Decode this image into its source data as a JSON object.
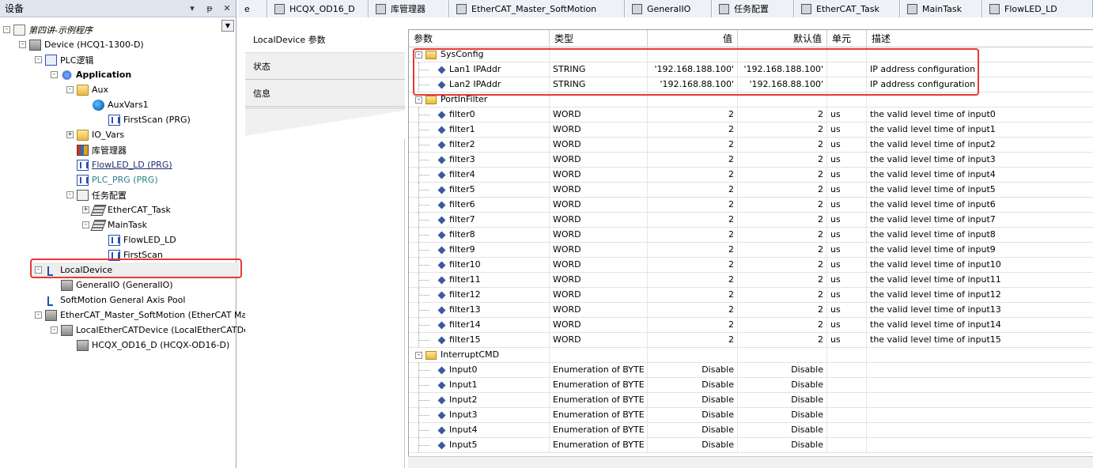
{
  "device_panel": {
    "title": "设备",
    "btn_dropdown": "▾",
    "btn_pin": "ᵽ",
    "btn_close": "✕",
    "tree_dropdown": "▼",
    "tree": [
      {
        "label": "第四讲-示例程序",
        "icon": "project-icon",
        "exp": "-",
        "style": "italic"
      },
      {
        "label": "Device (HCQ1-1300-D)",
        "icon": "device-icon",
        "exp": "-"
      },
      {
        "label": "PLC逻辑",
        "icon": "plc-logic-icon",
        "exp": "-"
      },
      {
        "label": "Application",
        "icon": "application-icon",
        "exp": "-",
        "style": "bold"
      },
      {
        "label": "Aux",
        "icon": "folder-icon",
        "exp": "-"
      },
      {
        "label": "AuxVars1",
        "icon": "global-vars-icon",
        "exp": ""
      },
      {
        "label": "FirstScan (PRG)",
        "icon": "program-icon",
        "exp": ""
      },
      {
        "label": "IO_Vars",
        "icon": "folder-icon",
        "exp": "+"
      },
      {
        "label": "库管理器",
        "icon": "library-manager-icon",
        "exp": ""
      },
      {
        "label": "FlowLED_LD (PRG)",
        "icon": "program-icon",
        "exp": "",
        "style": "underline-navy"
      },
      {
        "label": "PLC_PRG (PRG)",
        "icon": "program-icon",
        "exp": "",
        "style": "teal"
      },
      {
        "label": "任务配置",
        "icon": "task-config-icon",
        "exp": "-"
      },
      {
        "label": "EtherCAT_Task",
        "icon": "task-icon",
        "exp": "+"
      },
      {
        "label": "MainTask",
        "icon": "task-icon",
        "exp": "-"
      },
      {
        "label": "FlowLED_LD",
        "icon": "program-call-icon",
        "exp": ""
      },
      {
        "label": "FirstScan",
        "icon": "program-call-icon",
        "exp": ""
      },
      {
        "label": "LocalDevice",
        "icon": "local-device-icon",
        "exp": "-",
        "selected": true
      },
      {
        "label": "GeneralIO (GeneralIO)",
        "icon": "io-module-icon",
        "exp": ""
      },
      {
        "label": "SoftMotion General Axis Pool",
        "icon": "axis-pool-icon",
        "exp": ""
      },
      {
        "label": "EtherCAT_Master_SoftMotion (EtherCAT Mas",
        "icon": "ethercat-master-icon",
        "exp": "-"
      },
      {
        "label": "LocalEtherCATDevice (LocalEtherCATDev",
        "icon": "ethercat-device-icon",
        "exp": "-"
      },
      {
        "label": "HCQX_OD16_D (HCQX-OD16-D)",
        "icon": "io-module-icon",
        "exp": ""
      }
    ]
  },
  "tabs": [
    {
      "label": "e",
      "icon": ""
    },
    {
      "label": "HCQX_OD16_D",
      "icon": "device-icon"
    },
    {
      "label": "库管理器",
      "icon": "library-manager-icon"
    },
    {
      "label": "EtherCAT_Master_SoftMotion",
      "icon": "ethercat-master-icon"
    },
    {
      "label": "GeneralIO",
      "icon": "io-module-icon"
    },
    {
      "label": "任务配置",
      "icon": "task-config-icon"
    },
    {
      "label": "EtherCAT_Task",
      "icon": "task-icon"
    },
    {
      "label": "MainTask",
      "icon": "task-icon"
    },
    {
      "label": "FlowLED_LD",
      "icon": "program-icon"
    }
  ],
  "section_tabs": [
    {
      "label": "LocalDevice 参数",
      "active": true
    },
    {
      "label": "状态",
      "active": false
    },
    {
      "label": "信息",
      "active": false
    }
  ],
  "grid": {
    "headers": {
      "param": "参数",
      "type": "类型",
      "value": "值",
      "default": "默认值",
      "unit": "单元",
      "desc": "描述"
    },
    "groups": [
      {
        "name": "SysConfig",
        "rows": [
          {
            "param": "Lan1 IPAddr",
            "type": "STRING",
            "value": "'192.168.188.100'",
            "default": "'192.168.188.100'",
            "unit": "",
            "desc": "IP address configuration"
          },
          {
            "param": "Lan2 IPAddr",
            "type": "STRING",
            "value": "'192.168.88.100'",
            "default": "'192.168.88.100'",
            "unit": "",
            "desc": "IP address configuration"
          }
        ]
      },
      {
        "name": "PortInFilter",
        "rows": [
          {
            "param": "filter0",
            "type": "WORD",
            "value": "2",
            "default": "2",
            "unit": "us",
            "desc": "the valid level time of input0"
          },
          {
            "param": "filter1",
            "type": "WORD",
            "value": "2",
            "default": "2",
            "unit": "us",
            "desc": "the valid level time of input1"
          },
          {
            "param": "filter2",
            "type": "WORD",
            "value": "2",
            "default": "2",
            "unit": "us",
            "desc": "the valid level time of input2"
          },
          {
            "param": "filter3",
            "type": "WORD",
            "value": "2",
            "default": "2",
            "unit": "us",
            "desc": "the valid level time of input3"
          },
          {
            "param": "filter4",
            "type": "WORD",
            "value": "2",
            "default": "2",
            "unit": "us",
            "desc": "the valid level time of input4"
          },
          {
            "param": "filter5",
            "type": "WORD",
            "value": "2",
            "default": "2",
            "unit": "us",
            "desc": "the valid level time of input5"
          },
          {
            "param": "filter6",
            "type": "WORD",
            "value": "2",
            "default": "2",
            "unit": "us",
            "desc": "the valid level time of input6"
          },
          {
            "param": "filter7",
            "type": "WORD",
            "value": "2",
            "default": "2",
            "unit": "us",
            "desc": "the valid level time of input7"
          },
          {
            "param": "filter8",
            "type": "WORD",
            "value": "2",
            "default": "2",
            "unit": "us",
            "desc": "the valid level time of input8"
          },
          {
            "param": "filter9",
            "type": "WORD",
            "value": "2",
            "default": "2",
            "unit": "us",
            "desc": "the valid level time of input9"
          },
          {
            "param": "filter10",
            "type": "WORD",
            "value": "2",
            "default": "2",
            "unit": "us",
            "desc": "the valid level time of input10"
          },
          {
            "param": "filter11",
            "type": "WORD",
            "value": "2",
            "default": "2",
            "unit": "us",
            "desc": "the valid level time of input11"
          },
          {
            "param": "filter12",
            "type": "WORD",
            "value": "2",
            "default": "2",
            "unit": "us",
            "desc": "the valid level time of input12"
          },
          {
            "param": "filter13",
            "type": "WORD",
            "value": "2",
            "default": "2",
            "unit": "us",
            "desc": "the valid level time of input13"
          },
          {
            "param": "filter14",
            "type": "WORD",
            "value": "2",
            "default": "2",
            "unit": "us",
            "desc": "the valid level time of input14"
          },
          {
            "param": "filter15",
            "type": "WORD",
            "value": "2",
            "default": "2",
            "unit": "us",
            "desc": "the valid level time of input15"
          }
        ]
      },
      {
        "name": "InterruptCMD",
        "rows": [
          {
            "param": "Input0",
            "type": "Enumeration of BYTE",
            "value": "Disable",
            "default": "Disable",
            "unit": "",
            "desc": ""
          },
          {
            "param": "Input1",
            "type": "Enumeration of BYTE",
            "value": "Disable",
            "default": "Disable",
            "unit": "",
            "desc": ""
          },
          {
            "param": "Input2",
            "type": "Enumeration of BYTE",
            "value": "Disable",
            "default": "Disable",
            "unit": "",
            "desc": ""
          },
          {
            "param": "Input3",
            "type": "Enumeration of BYTE",
            "value": "Disable",
            "default": "Disable",
            "unit": "",
            "desc": ""
          },
          {
            "param": "Input4",
            "type": "Enumeration of BYTE",
            "value": "Disable",
            "default": "Disable",
            "unit": "",
            "desc": ""
          },
          {
            "param": "Input5",
            "type": "Enumeration of BYTE",
            "value": "Disable",
            "default": "Disable",
            "unit": "",
            "desc": ""
          }
        ]
      }
    ]
  },
  "colors": {
    "highlight_box": "#e53935",
    "panel_header": "#dfe6f0",
    "selection": "#eeeeee"
  }
}
